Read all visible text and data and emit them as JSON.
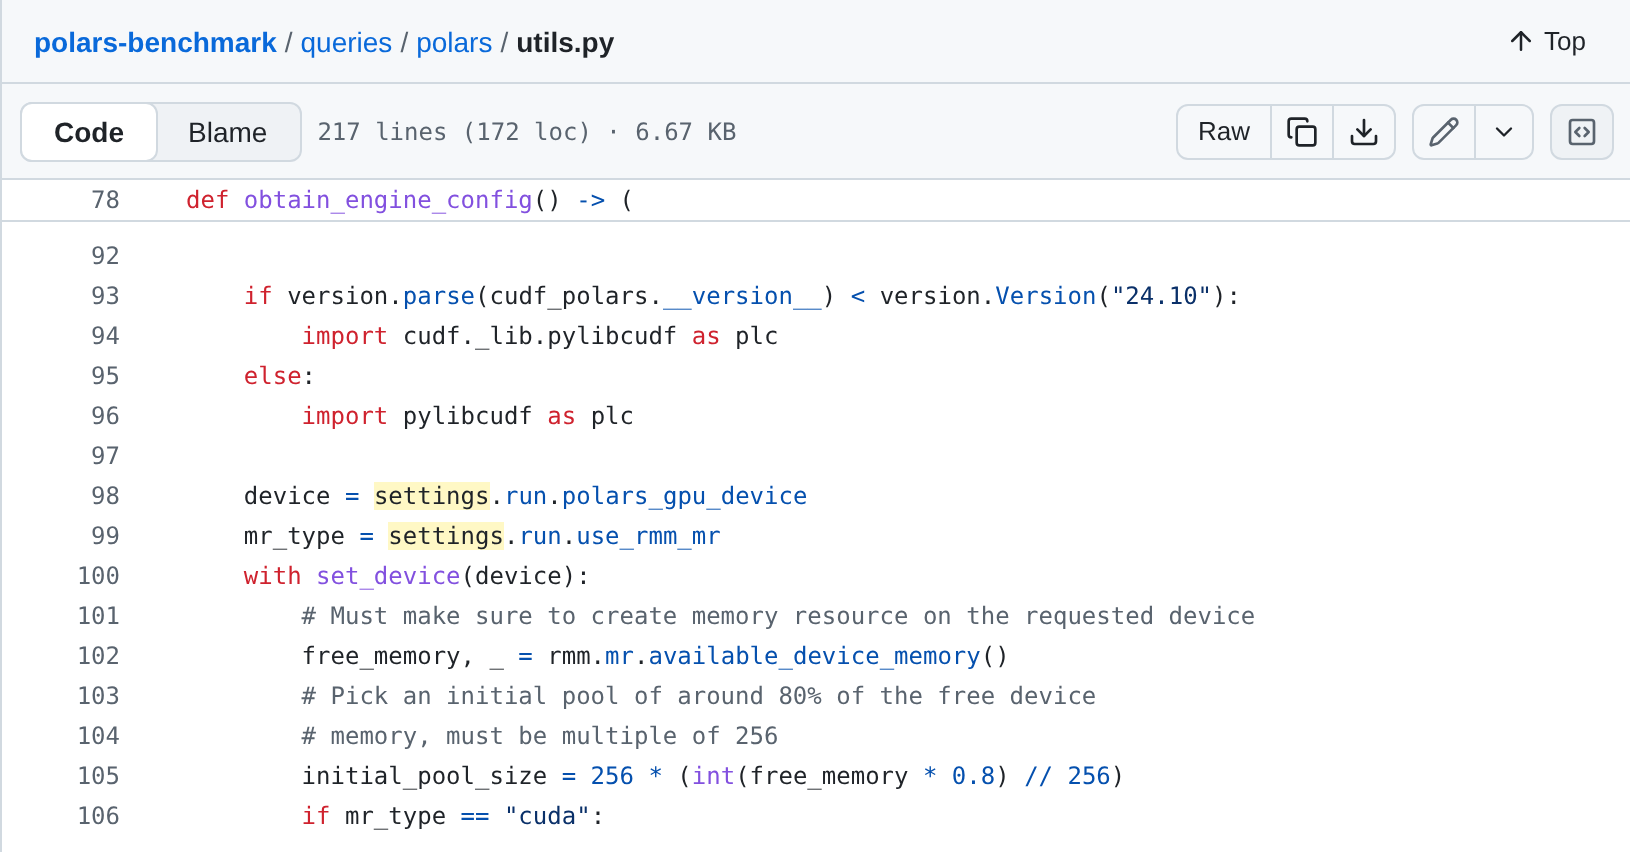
{
  "breadcrumb": {
    "items": [
      {
        "text": "polars-benchmark",
        "kind": "repo"
      },
      {
        "text": "queries",
        "kind": "dir"
      },
      {
        "text": "polars",
        "kind": "dir"
      },
      {
        "text": "utils.py",
        "kind": "file"
      }
    ],
    "separator": "/"
  },
  "top_button": "Top",
  "view_tabs": [
    {
      "label": "Code",
      "selected": true
    },
    {
      "label": "Blame",
      "selected": false
    }
  ],
  "file_info": "217 lines (172 loc) · 6.67 KB",
  "raw_button": "Raw",
  "sticky_line": {
    "number": "78",
    "tokens": [
      {
        "kind": "kw",
        "text": "def"
      },
      {
        "kind": "fn",
        "text": " obtain_engine_config"
      },
      {
        "kind": "plain",
        "text": "() "
      },
      {
        "kind": "op",
        "text": "->"
      },
      {
        "kind": "plain",
        "text": " ("
      }
    ]
  },
  "lines": [
    {
      "number": "92"
    },
    {
      "number": "93",
      "tokens": [
        {
          "kind": "kw",
          "text": "    if"
        },
        {
          "kind": "plain",
          "text": " version."
        },
        {
          "kind": "op",
          "text": "parse"
        },
        {
          "kind": "plain",
          "text": "(cudf_polars."
        },
        {
          "kind": "op",
          "text": "__version__"
        },
        {
          "kind": "plain",
          "text": ") "
        },
        {
          "kind": "op",
          "text": "<"
        },
        {
          "kind": "plain",
          "text": " version."
        },
        {
          "kind": "op",
          "text": "Version"
        },
        {
          "kind": "plain",
          "text": "("
        },
        {
          "kind": "str",
          "text": "\"24.10\""
        },
        {
          "kind": "plain",
          "text": "):"
        }
      ]
    },
    {
      "number": "94",
      "tokens": [
        {
          "kind": "kw",
          "text": "        import"
        },
        {
          "kind": "plain",
          "text": " cudf._lib.pylibcudf "
        },
        {
          "kind": "kw",
          "text": "as"
        },
        {
          "kind": "plain",
          "text": " plc"
        }
      ]
    },
    {
      "number": "95",
      "tokens": [
        {
          "kind": "kw",
          "text": "    else"
        },
        {
          "kind": "plain",
          "text": ":"
        }
      ]
    },
    {
      "number": "96",
      "tokens": [
        {
          "kind": "kw",
          "text": "        import"
        },
        {
          "kind": "plain",
          "text": " pylibcudf "
        },
        {
          "kind": "kw",
          "text": "as"
        },
        {
          "kind": "plain",
          "text": " plc"
        }
      ]
    },
    {
      "number": "97"
    },
    {
      "number": "98",
      "tokens": [
        {
          "kind": "plain",
          "text": "    device "
        },
        {
          "kind": "op",
          "text": "= "
        },
        {
          "kind": "hl",
          "text": "settings"
        },
        {
          "kind": "plain",
          "text": "."
        },
        {
          "kind": "op",
          "text": "run"
        },
        {
          "kind": "plain",
          "text": "."
        },
        {
          "kind": "op",
          "text": "polars_gpu_device"
        }
      ]
    },
    {
      "number": "99",
      "tokens": [
        {
          "kind": "plain",
          "text": "    mr_type "
        },
        {
          "kind": "op",
          "text": "= "
        },
        {
          "kind": "hl",
          "text": "settings"
        },
        {
          "kind": "plain",
          "text": "."
        },
        {
          "kind": "op",
          "text": "run"
        },
        {
          "kind": "plain",
          "text": "."
        },
        {
          "kind": "op",
          "text": "use_rmm_mr"
        }
      ]
    },
    {
      "number": "100",
      "tokens": [
        {
          "kind": "kw",
          "text": "    with"
        },
        {
          "kind": "fn",
          "text": " set_device"
        },
        {
          "kind": "plain",
          "text": "(device):"
        }
      ]
    },
    {
      "number": "101",
      "tokens": [
        {
          "kind": "comment",
          "text": "        # Must make sure to create memory resource on the requested device"
        }
      ]
    },
    {
      "number": "102",
      "tokens": [
        {
          "kind": "plain",
          "text": "        free_memory, _ "
        },
        {
          "kind": "op",
          "text": "="
        },
        {
          "kind": "plain",
          "text": " rmm."
        },
        {
          "kind": "op",
          "text": "mr"
        },
        {
          "kind": "plain",
          "text": "."
        },
        {
          "kind": "op",
          "text": "available_device_memory"
        },
        {
          "kind": "plain",
          "text": "()"
        }
      ]
    },
    {
      "number": "103",
      "tokens": [
        {
          "kind": "comment",
          "text": "        # Pick an initial pool of around 80% of the free device"
        }
      ]
    },
    {
      "number": "104",
      "tokens": [
        {
          "kind": "comment",
          "text": "        # memory, must be multiple of 256"
        }
      ]
    },
    {
      "number": "105",
      "tokens": [
        {
          "kind": "plain",
          "text": "        initial_pool_size "
        },
        {
          "kind": "op",
          "text": "= 256 *"
        },
        {
          "kind": "plain",
          "text": " ("
        },
        {
          "kind": "fn",
          "text": "int"
        },
        {
          "kind": "plain",
          "text": "(free_memory "
        },
        {
          "kind": "op",
          "text": "* 0.8"
        },
        {
          "kind": "plain",
          "text": ") "
        },
        {
          "kind": "op",
          "text": "// 256"
        },
        {
          "kind": "plain",
          "text": ")"
        }
      ]
    },
    {
      "number": "106",
      "tokens": [
        {
          "kind": "kw",
          "text": "        if"
        },
        {
          "kind": "plain",
          "text": " mr_type "
        },
        {
          "kind": "op",
          "text": "=="
        },
        {
          "kind": "str",
          "text": " \"cuda\""
        },
        {
          "kind": "plain",
          "text": ":"
        }
      ]
    }
  ]
}
